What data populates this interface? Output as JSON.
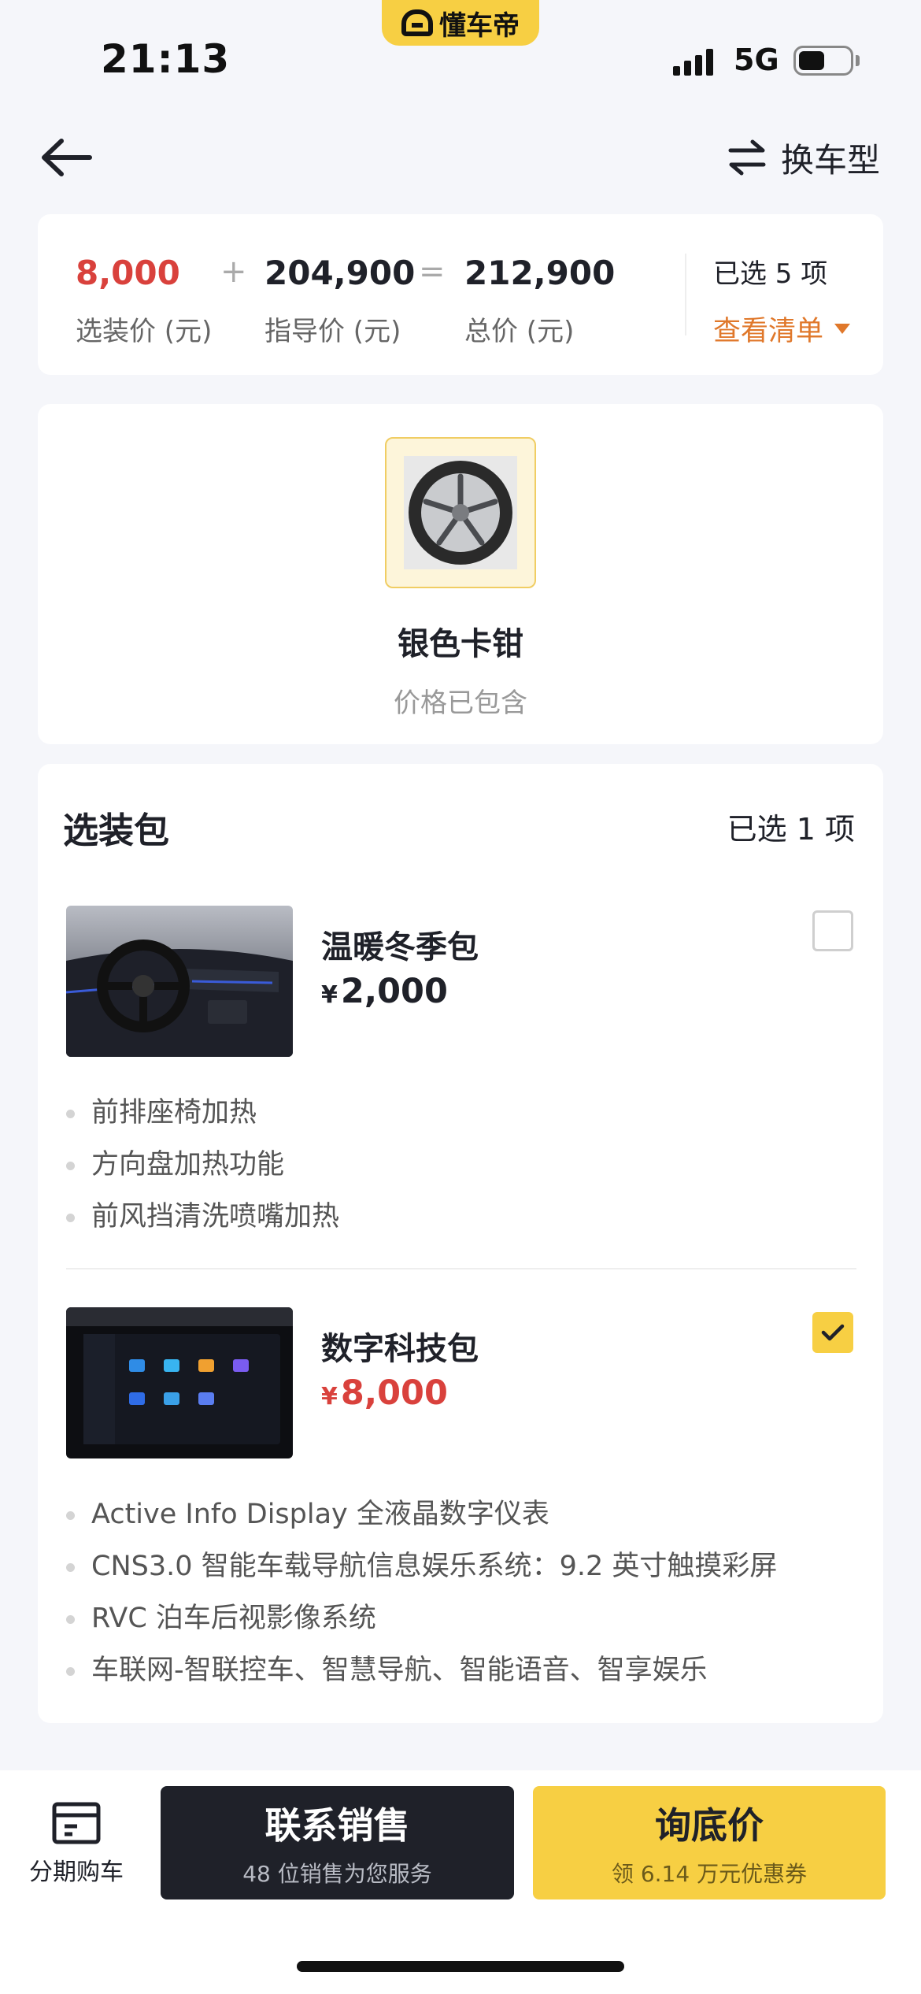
{
  "status_bar": {
    "time": "21:13",
    "network": "5G",
    "app_badge": "懂车帝"
  },
  "nav": {
    "switch_label": "换车型"
  },
  "summary": {
    "option_price": "8,000",
    "option_price_label": "选装价 (元)",
    "op_plus": "+",
    "guide_price": "204,900",
    "guide_price_label": "指导价 (元)",
    "op_equals": "=",
    "total_price": "212,900",
    "total_price_label": "总价 (元)",
    "selected_count": "已选 5 项",
    "view_list": "查看清单",
    "accent_color": "#e0782b",
    "price_red": "#d9413c"
  },
  "caliper": {
    "name": "银色卡钳",
    "note": "价格已包含"
  },
  "packages": {
    "title": "选装包",
    "selected_count": "已选 1 项",
    "items": [
      {
        "name": "温暖冬季包",
        "currency": "¥",
        "price": "2,000",
        "checked": false,
        "features": [
          "前排座椅加热",
          "方向盘加热功能",
          "前风挡清洗喷嘴加热"
        ]
      },
      {
        "name": "数字科技包",
        "currency": "¥",
        "price": "8,000",
        "checked": true,
        "features": [
          "Active Info Display 全液晶数字仪表",
          "CNS3.0 智能车载导航信息娱乐系统：9.2 英寸触摸彩屏",
          "RVC 泊车后视影像系统",
          "车联网-智联控车、智慧导航、智能语音、智享娱乐"
        ]
      }
    ]
  },
  "bottom_bar": {
    "installment_label": "分期购车",
    "contact_main": "联系销售",
    "contact_sub": "48 位销售为您服务",
    "quote_main": "询底价",
    "quote_sub": "领 6.14 万元优惠券",
    "brand_yellow": "#f7cf43"
  }
}
